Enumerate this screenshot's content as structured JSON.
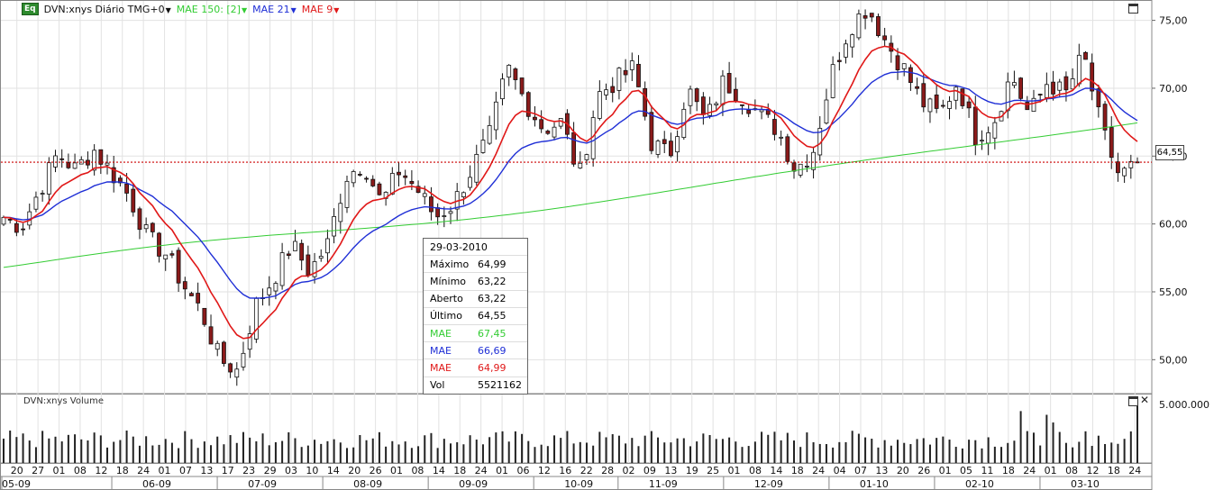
{
  "header": {
    "badge": "Eq",
    "symbol_label": "DVN:xnys Diário TMG+0",
    "mae150_label": "MAE 150: [2]",
    "mae21_label": "MAE 21",
    "mae9_label": "MAE 9"
  },
  "colors": {
    "mae150": "#33cc33",
    "mae21": "#1f2fd6",
    "mae9": "#e01818",
    "candle_up": "#ffffff",
    "candle_down": "#8b1a1a",
    "last_line": "#cc0000"
  },
  "last_price_label": "64,55",
  "volume_title": "DVN:xnys Volume",
  "volume_axis_label": "5.000.000",
  "info_box": {
    "date": "29-03-2010",
    "rows": [
      {
        "k": "Máximo",
        "v": "64,99",
        "color": "#000000"
      },
      {
        "k": "Mínimo",
        "v": "63,22",
        "color": "#000000"
      },
      {
        "k": "Aberto",
        "v": "63,22",
        "color": "#000000"
      },
      {
        "k": "Último",
        "v": "64,55",
        "color": "#000000"
      },
      {
        "k": "MAE",
        "v": "67,45",
        "color": "#33cc33"
      },
      {
        "k": "MAE",
        "v": "66,69",
        "color": "#1f2fd6"
      },
      {
        "k": "MAE",
        "v": "64,99",
        "color": "#e01818"
      },
      {
        "k": "Vol",
        "v": "5521162",
        "color": "#000000"
      }
    ]
  },
  "chart_data": {
    "type": "candlestick",
    "ylim": [
      47.5,
      76.5
    ],
    "y_ticks": [
      {
        "v": 50,
        "label": "50,00"
      },
      {
        "v": 55,
        "label": "55,00"
      },
      {
        "v": 60,
        "label": "60,00"
      },
      {
        "v": 65,
        "label": "65,00"
      },
      {
        "v": 70,
        "label": "70,00"
      },
      {
        "v": 75,
        "label": "75,00"
      }
    ],
    "last_price": 64.55,
    "day_labels": [
      "20",
      "27",
      "01",
      "08",
      "12",
      "18",
      "24",
      "01",
      "07",
      "13",
      "17",
      "23",
      "29",
      "03",
      "10",
      "14",
      "20",
      "26",
      "01",
      "08",
      "14",
      "18",
      "24",
      "01",
      "06",
      "12",
      "16",
      "22",
      "28",
      "02",
      "09",
      "13",
      "19",
      "25",
      "01",
      "08",
      "14",
      "18",
      "24",
      "04",
      "07",
      "13",
      "20",
      "26",
      "01",
      "05",
      "11",
      "18",
      "24",
      "01",
      "08",
      "12",
      "18",
      "24"
    ],
    "month_labels": [
      "05-09",
      "06-09",
      "07-09",
      "08-09",
      "09-09",
      "10-09",
      "11-09",
      "12-09",
      "01-10",
      "02-10",
      "03-10"
    ],
    "close_anchors": [
      60.5,
      59.8,
      62.5,
      65.2,
      64.0,
      65.5,
      63.8,
      62.0,
      59.0,
      57.8,
      55.5,
      53.5,
      50.0,
      49.2,
      54.0,
      56.0,
      58.5,
      56.5,
      58.5,
      63.5,
      64.5,
      61.5,
      64.0,
      62.5,
      60.5,
      61.5,
      64.0,
      66.5,
      71.5,
      69.0,
      67.0,
      67.5,
      63.5,
      69.5,
      70.5,
      71.5,
      66.0,
      65.0,
      70.0,
      67.5,
      70.5,
      69.5,
      68.0,
      67.0,
      64.0,
      65.5,
      71.0,
      74.5,
      76.0,
      73.5,
      71.5,
      69.0,
      68.0,
      70.5,
      66.5,
      67.5,
      71.0,
      68.0,
      70.5,
      69.5,
      72.5,
      67.0,
      63.5,
      64.5
    ],
    "volume_ylim": [
      0,
      5000000
    ],
    "last_volume": 5521162,
    "mae_last": {
      "mae150": 67.45,
      "mae21": 66.69,
      "mae9": 64.99
    }
  }
}
